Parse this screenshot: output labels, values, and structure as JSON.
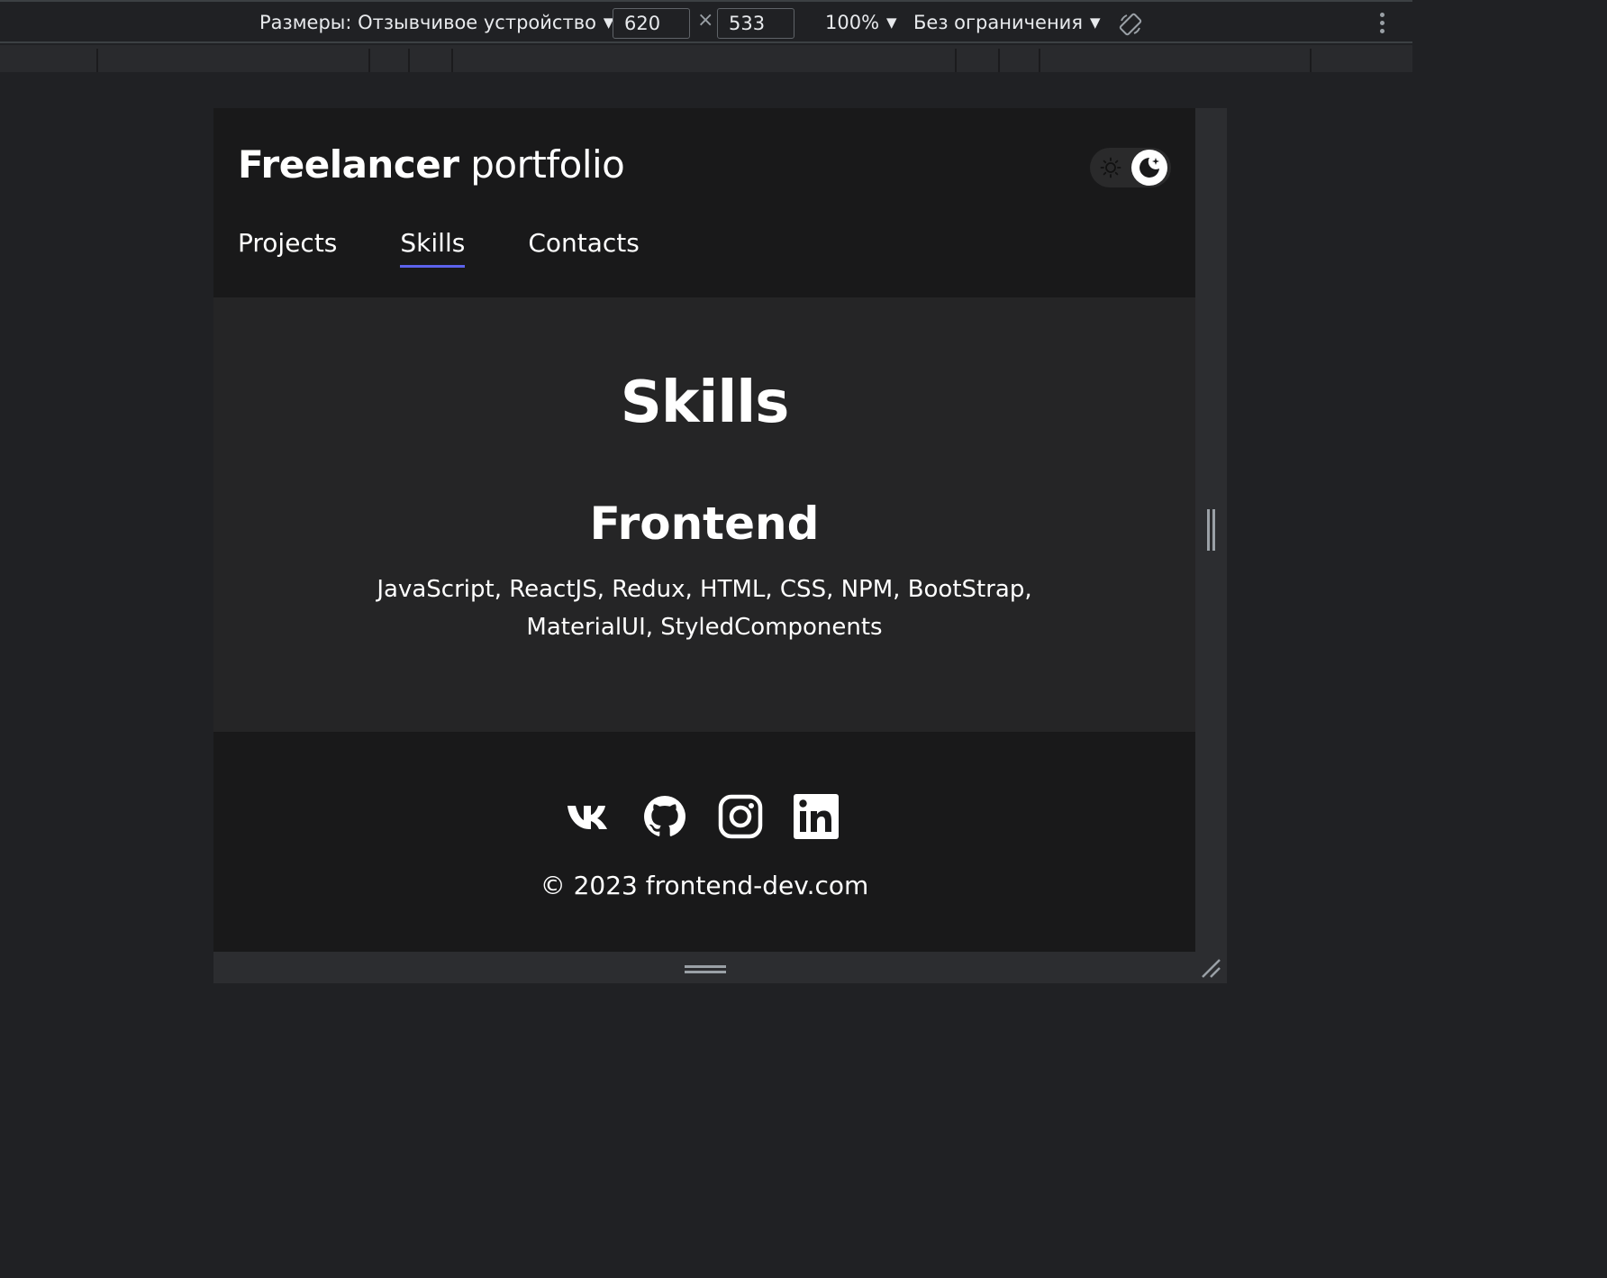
{
  "devtools": {
    "dimensions_label": "Размеры: Отзывчивое устройство",
    "width_value": "620",
    "height_value": "533",
    "times_glyph": "×",
    "zoom": "100%",
    "throttle": "Без ограничения",
    "caret_glyph": "▼"
  },
  "site": {
    "brand_bold": "Freelancer",
    "brand_light": " portfolio",
    "nav": [
      {
        "label": "Projects",
        "active": false
      },
      {
        "label": "Skills",
        "active": true
      },
      {
        "label": "Contacts",
        "active": false
      }
    ],
    "page_title": "Skills",
    "section_title": "Frontend",
    "skills_text": "JavaScript, ReactJS, Redux, HTML, CSS, NPM, BootStrap, MaterialUI, StyledComponents",
    "socials": [
      "vk-icon",
      "github-icon",
      "instagram-icon",
      "linkedin-icon"
    ],
    "copyright": "© 2023 frontend-dev.com"
  },
  "colors": {
    "accent": "#5c62ec",
    "header_bg": "#19191a",
    "main_bg": "#252526",
    "devtools_bg": "#202124"
  }
}
